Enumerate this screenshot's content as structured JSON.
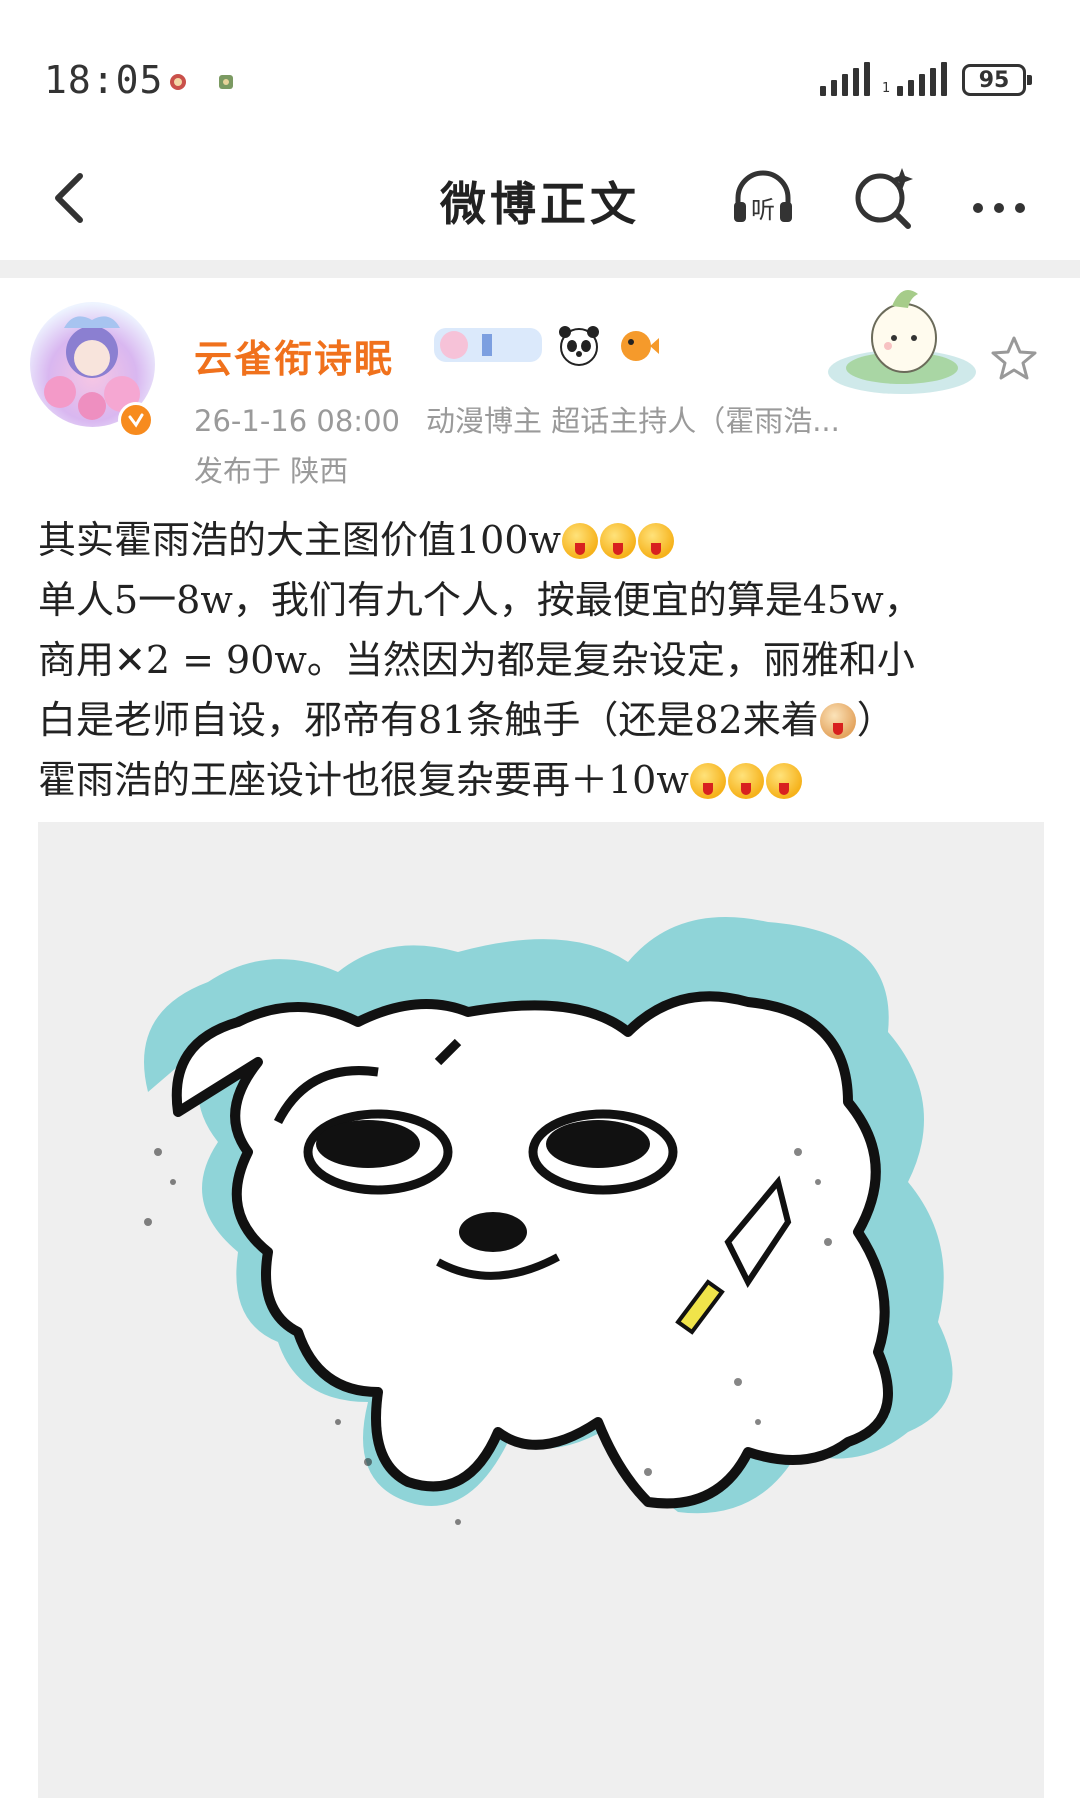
{
  "status_bar": {
    "time": "18:05",
    "network_label_1": "",
    "network_label_2": "1",
    "battery": "95"
  },
  "header": {
    "title": "微博正文",
    "listen_label": "听"
  },
  "post": {
    "username": "云雀衔诗眠",
    "meta_time": "26-1-16 08:00",
    "meta_roles": "动漫博主 超话主持人（霍雨浩...",
    "location": "发布于 陕西",
    "lines": [
      "其实霍雨浩的大主图价值100w",
      "单人5一8w，我们有九个人，按最便宜的算是45w，",
      "商用✕2 = 90w。当然因为都是复杂设定，丽雅和小",
      "白是老师自设，邪帝有81条触手（还是82来着",
      "霍雨浩的王座设计也很复杂要再＋10w"
    ],
    "line4_tail": "）"
  },
  "colors": {
    "username": "#f0711c",
    "verified_badge": "#f78b1e",
    "meta_text": "#9a9a9a",
    "image_outline": "#8fd4d8"
  },
  "icons": [
    "back-icon",
    "headphone-icon",
    "sparkle-search-icon",
    "more-icon",
    "star-icon",
    "verified-icon"
  ]
}
